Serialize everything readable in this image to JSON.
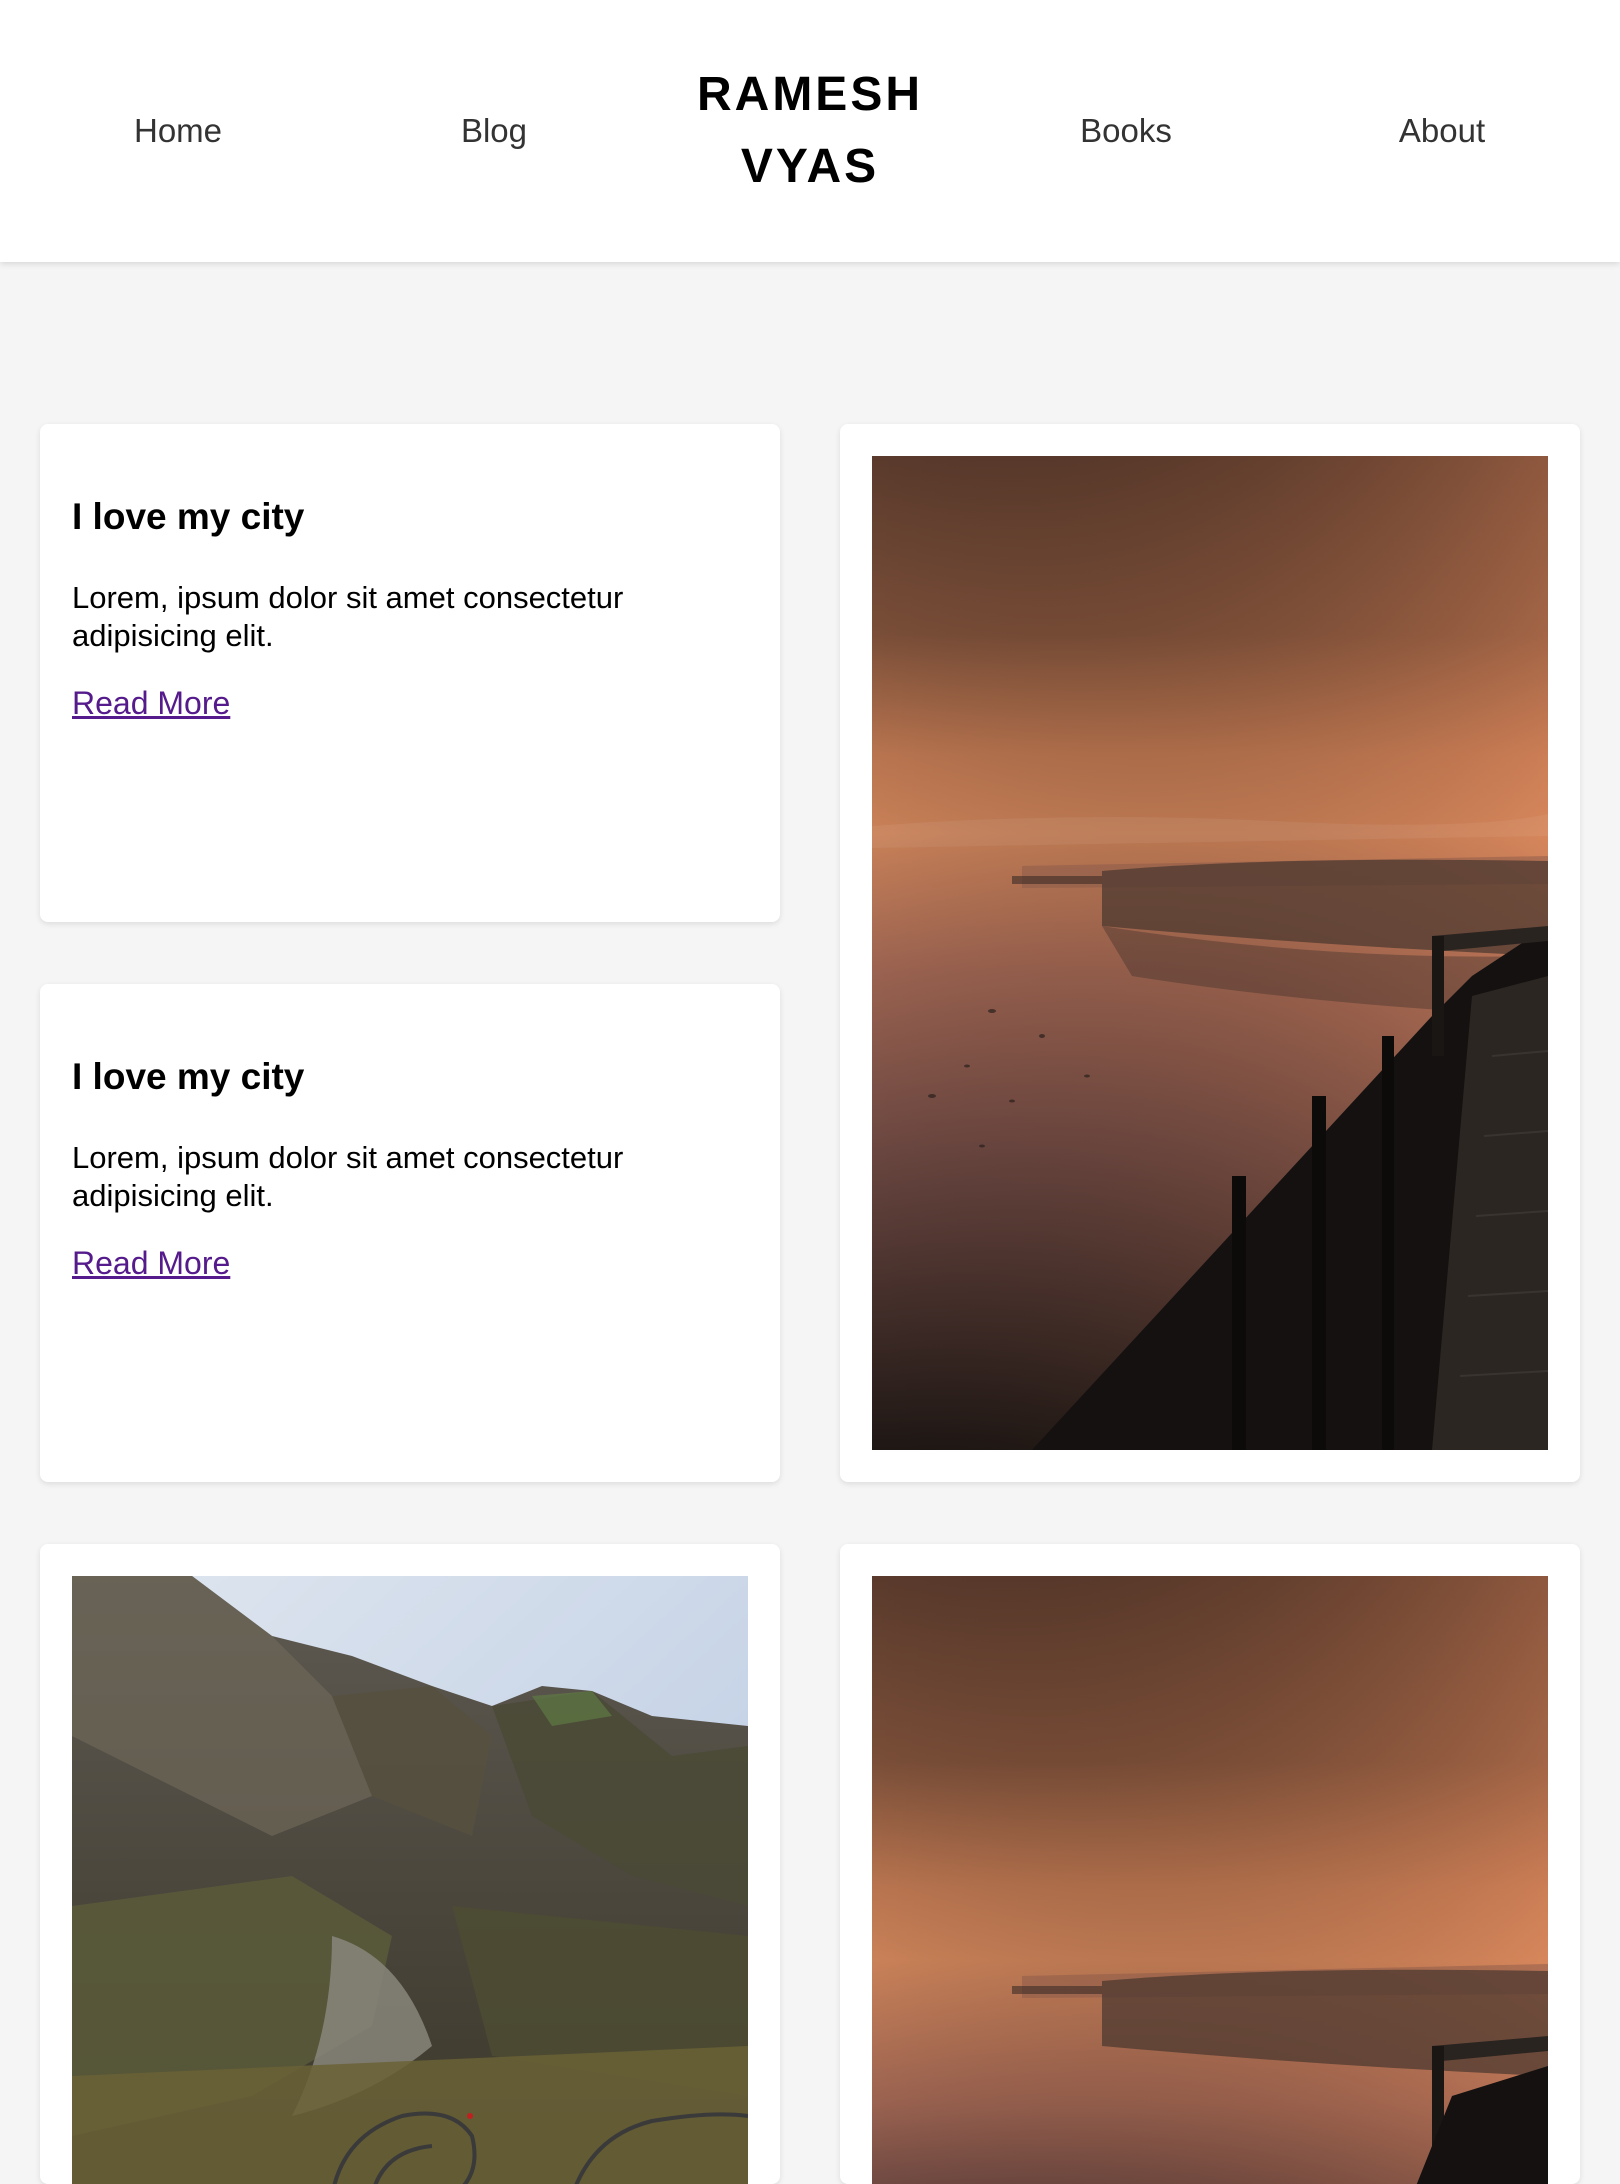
{
  "header": {
    "nav": [
      {
        "label": "Home"
      },
      {
        "label": "Blog"
      },
      {
        "label": "Books"
      },
      {
        "label": "About"
      }
    ],
    "brand_line1": "RAMESH",
    "brand_line2": "VYAS"
  },
  "posts": [
    {
      "title": "I love my city",
      "excerpt": "Lorem, ipsum dolor sit amet consectetur adipisicing elit.",
      "link_label": "Read More"
    },
    {
      "title": "I love my city",
      "excerpt": "Lorem, ipsum dolor sit amet consectetur adipisicing elit.",
      "link_label": "Read More"
    }
  ],
  "colors": {
    "background": "#f5f5f5",
    "card": "#ffffff",
    "link": "#551a8b",
    "nav_text": "#333333"
  }
}
